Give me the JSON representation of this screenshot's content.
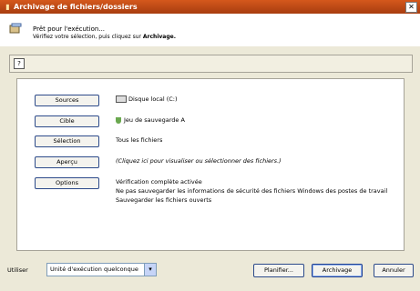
{
  "window": {
    "title": "Archivage de fichiers/dossiers",
    "close_icon": "close-icon"
  },
  "header": {
    "title": "Prêt pour l'exécution...",
    "subtitle_prefix": "Vérifiez votre sélection, puis cliquez sur ",
    "subtitle_action": "Archivage."
  },
  "help": {
    "icon_text": "?"
  },
  "rows": {
    "sources": {
      "button": "Sources",
      "text": "Disque local (C:)"
    },
    "cible": {
      "button": "Cible",
      "text": "Jeu de sauvegarde A"
    },
    "selection": {
      "button": "Sélection",
      "text": "Tous les fichiers"
    },
    "apercu": {
      "button": "Aperçu",
      "text": "(Cliquez ici pour visualiser ou sélectionner des fichiers.)"
    },
    "options": {
      "button": "Options",
      "line1": "Vérification complète activée",
      "line2": "Ne pas sauvegarder les informations de sécurité des fichiers Windows des postes de travail",
      "line3": "Sauvegarder les fichiers ouverts"
    }
  },
  "footer": {
    "utiliser_label": "Utiliser",
    "device_value": "Unité d'exécution quelconque",
    "planifier_label": "Planifier...",
    "archivage_label": "Archivage",
    "annuler_label": "Annuler"
  }
}
